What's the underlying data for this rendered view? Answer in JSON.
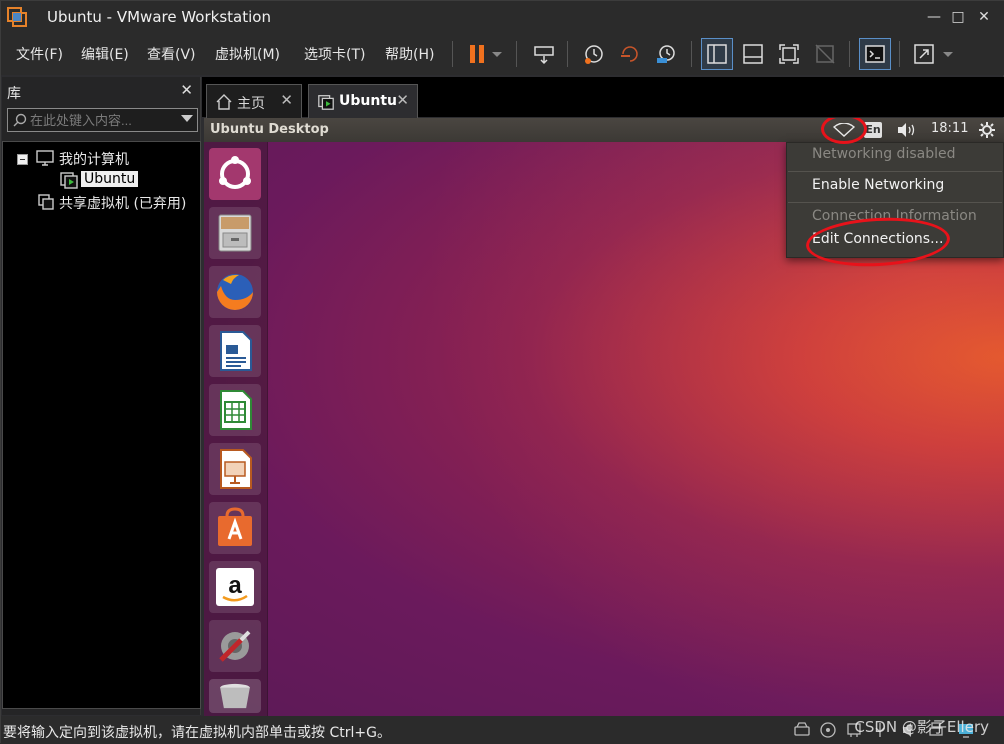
{
  "window": {
    "title": "Ubuntu - VMware Workstation"
  },
  "menu": [
    "文件(F)",
    "编辑(E)",
    "查看(V)",
    "虚拟机(M)",
    "选项卡(T)",
    "帮助(H)"
  ],
  "library": {
    "title": "库",
    "search_placeholder": "在此处键入内容...",
    "tree": {
      "my_computer": "我的计算机",
      "vm": "Ubuntu",
      "shared": "共享虚拟机 (已弃用)"
    }
  },
  "tabs": [
    {
      "label": "主页",
      "icon": "home-icon"
    },
    {
      "label": "Ubuntu",
      "icon": "vm-running-icon"
    }
  ],
  "guest": {
    "panel_title": "Ubuntu Desktop",
    "keyboard": "En",
    "time": "18:11",
    "launcher_apps": [
      "ubuntu-dash",
      "files",
      "firefox",
      "libreoffice-writer",
      "libreoffice-calc",
      "libreoffice-impress",
      "ubuntu-software",
      "amazon",
      "system-settings",
      "trash"
    ],
    "network_menu": {
      "disabled_label": "Networking disabled",
      "enable_label": "Enable Networking",
      "info_label": "Connection Information",
      "edit_label": "Edit Connections..."
    }
  },
  "status": {
    "text": "要将输入定向到该虚拟机，请在虚拟机内部单击或按 Ctrl+G。",
    "watermark": "CSDN @影子Ellery"
  },
  "colors": {
    "accent": "#e8121a",
    "wallpaper": "#7a1f5a",
    "pause": "#f0711e"
  }
}
